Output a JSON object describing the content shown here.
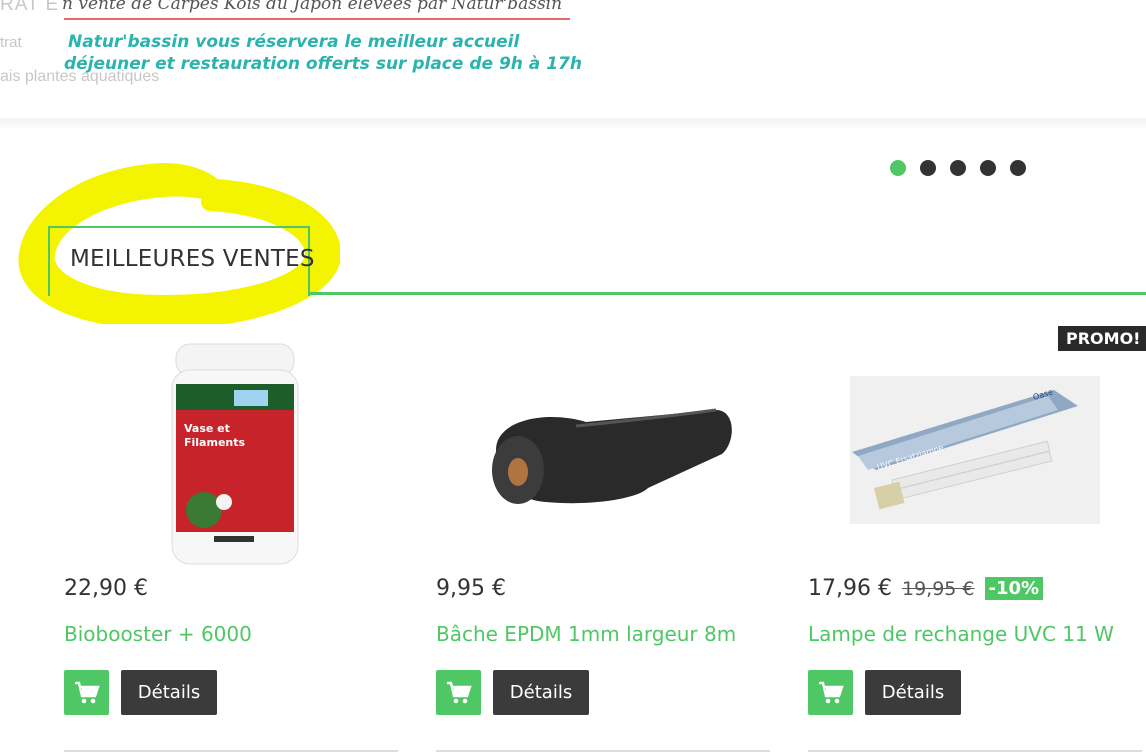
{
  "banner": {
    "ghost_menu": [
      "RAT E",
      "trat",
      "ais plantes aquatiques"
    ],
    "line1": "n vente de Carpes Koïs du Japon élevées par Natur'bassin",
    "line2": "Natur'bassin vous réservera le meilleur accueil",
    "line3": "déjeuner et restauration offerts sur place de 9h à 17h"
  },
  "slider": {
    "dot_count": 5,
    "active_index": 0
  },
  "section": {
    "title": "MEILLEURES VENTES"
  },
  "promo_badge": "PROMO!",
  "products": [
    {
      "price": "22,90 €",
      "name": "Biobooster + 6000",
      "details_label": "Détails",
      "image_text": [
        "Vase et",
        "Filaments"
      ]
    },
    {
      "price": "9,95 €",
      "name": "Bâche EPDM 1mm largeur 8m",
      "details_label": "Détails"
    },
    {
      "price": "17,96 €",
      "old_price": "19,95 €",
      "discount": "-10%",
      "name": "Lampe de rechange UVC 11 W",
      "details_label": "Détails",
      "image_text": [
        "UVC Ersatzlampe",
        "Oase"
      ]
    }
  ],
  "colors": {
    "accent": "#4fc765",
    "dark_button": "#3b3b3b",
    "teal_text": "#2bb3ad",
    "highlight": "#f4f400"
  },
  "icons": {
    "cart": "shopping-cart-icon"
  }
}
